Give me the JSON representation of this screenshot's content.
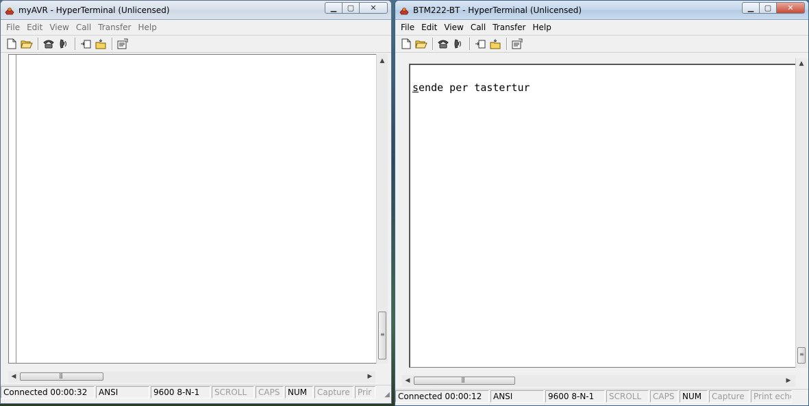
{
  "windows": [
    {
      "title": "myAVR - HyperTerminal (Unlicensed)",
      "active": false,
      "menu": [
        "File",
        "Edit",
        "View",
        "Call",
        "Transfer",
        "Help"
      ],
      "terminal_text": "",
      "status": [
        {
          "text": "Connected 00:00:32",
          "enabled": true
        },
        {
          "text": "ANSI",
          "enabled": true
        },
        {
          "text": "9600 8-N-1",
          "enabled": true
        },
        {
          "text": "SCROLL",
          "enabled": false
        },
        {
          "text": "CAPS",
          "enabled": false
        },
        {
          "text": "NUM",
          "enabled": true
        },
        {
          "text": "Capture",
          "enabled": false
        },
        {
          "text": "Prir",
          "enabled": false
        }
      ]
    },
    {
      "title": "BTM222-BT - HyperTerminal (Unlicensed)",
      "active": true,
      "menu": [
        "File",
        "Edit",
        "View",
        "Call",
        "Transfer",
        "Help"
      ],
      "terminal_text_first": "s",
      "terminal_text_rest": "ende per tastertur",
      "status": [
        {
          "text": "Connected 00:00:12",
          "enabled": true
        },
        {
          "text": "ANSI",
          "enabled": true
        },
        {
          "text": "9600 8-N-1",
          "enabled": true
        },
        {
          "text": "SCROLL",
          "enabled": false
        },
        {
          "text": "CAPS",
          "enabled": false
        },
        {
          "text": "NUM",
          "enabled": true
        },
        {
          "text": "Capture",
          "enabled": false
        },
        {
          "text": "Print echc",
          "enabled": false
        }
      ]
    }
  ],
  "toolbar_icons": [
    "new-document-icon",
    "open-folder-icon",
    "connect-phone-icon",
    "disconnect-phone-icon",
    "send-file-icon",
    "receive-file-icon",
    "properties-icon"
  ],
  "colors": {
    "accent_close": "#c74a36",
    "terminal_bg": "#ffffff"
  }
}
